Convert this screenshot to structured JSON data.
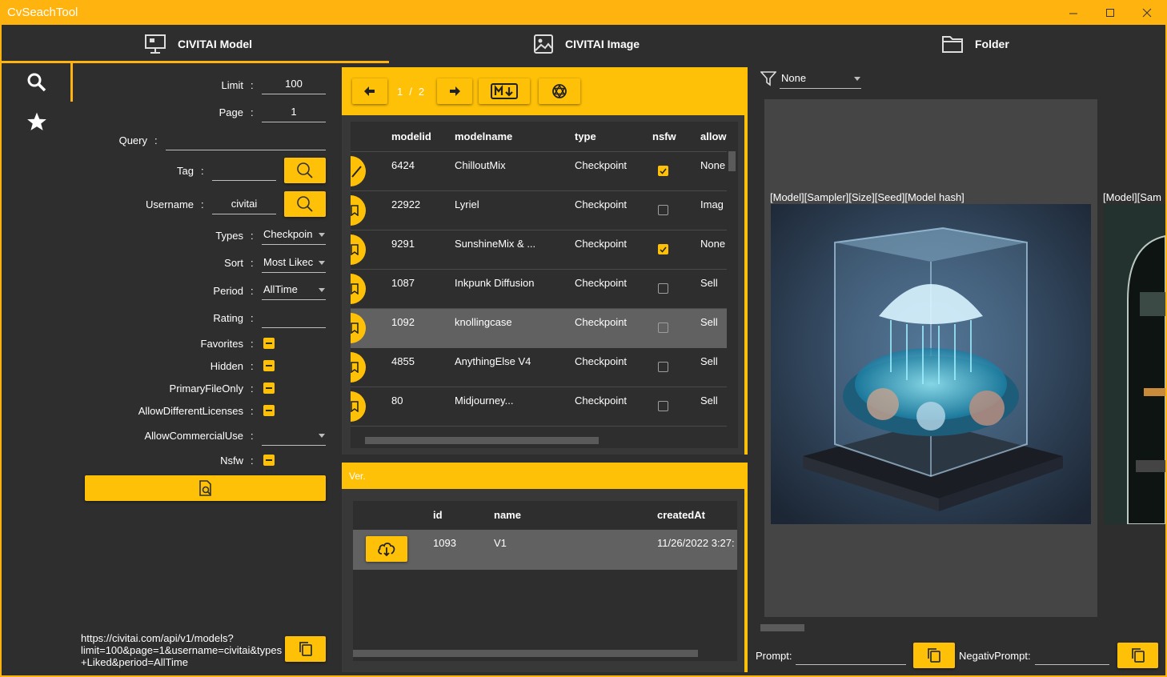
{
  "app": {
    "title": "CvSeachTool"
  },
  "tabs": [
    {
      "label": "CIVITAI Model",
      "icon": "monitor-icon"
    },
    {
      "label": "CIVITAI Image",
      "icon": "image-icon"
    },
    {
      "label": "Folder",
      "icon": "folder-icon"
    }
  ],
  "rail": [
    {
      "icon": "search-icon"
    },
    {
      "icon": "star-icon"
    }
  ],
  "form": {
    "limit": {
      "label": "Limit",
      "value": "100"
    },
    "page": {
      "label": "Page",
      "value": "1"
    },
    "query": {
      "label": "Query",
      "value": ""
    },
    "tag": {
      "label": "Tag",
      "value": ""
    },
    "username": {
      "label": "Username",
      "value": "civitai"
    },
    "types": {
      "label": "Types",
      "value": "Checkpoin"
    },
    "sort": {
      "label": "Sort",
      "value": "Most Likec"
    },
    "period": {
      "label": "Period",
      "value": "AllTime"
    },
    "rating": {
      "label": "Rating",
      "value": ""
    },
    "favorites": {
      "label": "Favorites"
    },
    "hidden": {
      "label": "Hidden"
    },
    "primary_file_only": {
      "label": "PrimaryFileOnly"
    },
    "allow_different_licenses": {
      "label": "AllowDifferentLicenses"
    },
    "allow_commercial_use": {
      "label": "AllowCommercialUse",
      "value": ""
    },
    "nsfw": {
      "label": "Nsfw"
    },
    "colon": ":"
  },
  "url": {
    "text": "https://civitai.com/api/v1/models?limit=100&page=1&username=civitai&types+Liked&period=AllTime",
    "line1": "https://civitai.com/api/v1/models?",
    "line2": "limit=100&page=1&username=civitai&types",
    "line3": "+Liked&period=AllTime"
  },
  "pager": {
    "current": "1",
    "separator": "/",
    "total": "2"
  },
  "models": {
    "columns": [
      "modelid",
      "modelname",
      "type",
      "nsfw",
      "allow"
    ],
    "rows": [
      {
        "modelid": "6424",
        "modelname": "ChilloutMix",
        "type": "Checkpoint",
        "nsfw": true,
        "allow": "None"
      },
      {
        "modelid": "22922",
        "modelname": "Lyriel",
        "type": "Checkpoint",
        "nsfw": false,
        "allow": "Imag"
      },
      {
        "modelid": "9291",
        "modelname": "SunshineMix & ...",
        "type": "Checkpoint",
        "nsfw": true,
        "allow": "None"
      },
      {
        "modelid": "1087",
        "modelname": "Inkpunk Diffusion",
        "type": "Checkpoint",
        "nsfw": false,
        "allow": "Sell"
      },
      {
        "modelid": "1092",
        "modelname": "knollingcase",
        "type": "Checkpoint",
        "nsfw": false,
        "allow": "Sell",
        "selected": true
      },
      {
        "modelid": "4855",
        "modelname": "AnythingElse V4",
        "type": "Checkpoint",
        "nsfw": false,
        "allow": "Sell"
      },
      {
        "modelid": "80",
        "modelname": "Midjourney...",
        "type": "Checkpoint",
        "nsfw": false,
        "allow": "Sell"
      }
    ]
  },
  "versions": {
    "header": "Ver.",
    "columns": [
      "id",
      "name",
      "createdAt"
    ],
    "rows": [
      {
        "id": "1093",
        "name": "V1",
        "createdAt": "11/26/2022 3:27:"
      }
    ]
  },
  "images": {
    "filter_value": "None",
    "caption1": "[Model][Sampler][Size][Seed][Model hash]",
    "caption2": "[Model][Sam"
  },
  "bottom": {
    "prompt_label": "Prompt:",
    "negative_label": "NegativPrompt:"
  },
  "colors": {
    "accent": "#ffc107",
    "titlebar": "#ffb30f",
    "background": "#2e2e2e"
  }
}
